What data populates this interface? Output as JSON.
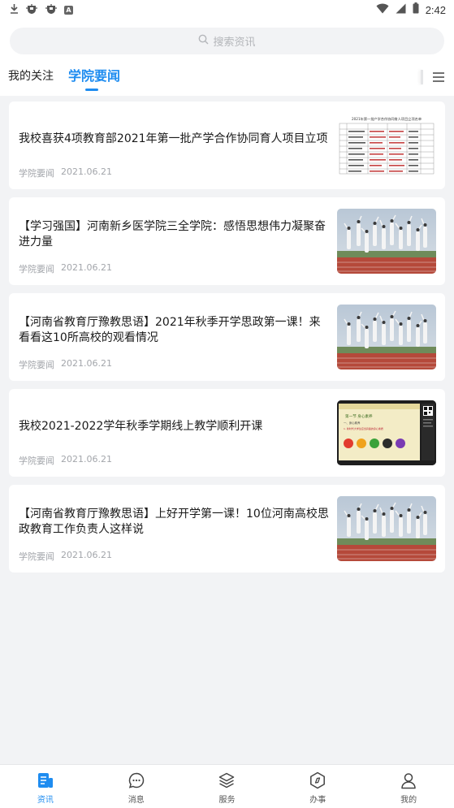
{
  "status_bar": {
    "time": "2:42",
    "left_icons": [
      "download-icon",
      "bug-icon",
      "bug-icon",
      "a-icon"
    ],
    "right_icons": [
      "wifi-icon",
      "signal-icon",
      "battery-icon"
    ]
  },
  "search": {
    "placeholder": "搜索资讯"
  },
  "tabs": {
    "follow": "我的关注",
    "news": "学院要闻",
    "active": "news",
    "accent_color": "#1e8cf0"
  },
  "articles": [
    {
      "title": "我校喜获4项教育部2021年第一批产学合作协同育人项目立项",
      "category": "学院要闻",
      "date": "2021.06.21",
      "thumb": "document-table",
      "thumb_caption": "2021年第一批产学合作协同育人项目立项名单"
    },
    {
      "title": "【学习强国】河南新乡医学院三全学院：感悟思想伟力凝聚奋进力量",
      "category": "学院要闻",
      "date": "2021.06.21",
      "thumb": "students-photo"
    },
    {
      "title": "【河南省教育厅豫教思语】2021年秋季开学思政第一课！来看看这10所高校的观看情况",
      "category": "学院要闻",
      "date": "2021.06.21",
      "thumb": "students-photo"
    },
    {
      "title": "我校2021-2022学年秋季学期线上教学顺利开课",
      "category": "学院要闻",
      "date": "2021.06.21",
      "thumb": "online-class",
      "thumb_caption": "第一节 身心素养",
      "thumb_lines": [
        "一、身心素养",
        "1. 新时代大学生应当具备的身心素质"
      ]
    },
    {
      "title": "【河南省教育厅豫教思语】上好开学第一课！10位河南高校思政教育工作负责人这样说",
      "category": "学院要闻",
      "date": "2021.06.21",
      "thumb": "students-photo"
    }
  ],
  "tabbar": [
    {
      "label": "资讯",
      "icon": "news-icon",
      "active": true
    },
    {
      "label": "消息",
      "icon": "chat-bubble-icon",
      "active": false
    },
    {
      "label": "服务",
      "icon": "layers-icon",
      "active": false
    },
    {
      "label": "办事",
      "icon": "compass-icon",
      "active": false
    },
    {
      "label": "我的",
      "icon": "user-icon",
      "active": false
    }
  ]
}
